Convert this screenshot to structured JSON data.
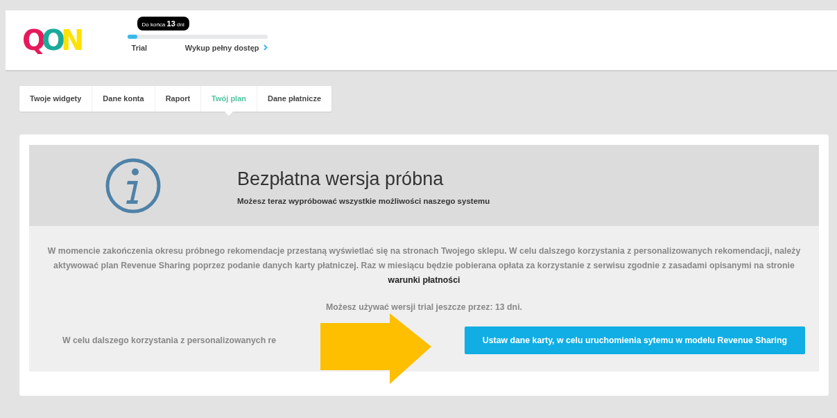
{
  "header": {
    "logo": "QON",
    "trial": {
      "badge_prefix": "Do końca",
      "badge_days": "13",
      "badge_suffix": "dni",
      "level": 0.07,
      "label": "Trial",
      "upgrade_link": "Wykup pełny dostęp"
    }
  },
  "tabs": [
    {
      "label": "Twoje widgety",
      "selected": false
    },
    {
      "label": "Dane konta",
      "selected": false
    },
    {
      "label": "Raport",
      "selected": false
    },
    {
      "label": "Twój plan",
      "selected": true
    },
    {
      "label": "Dane płatnicze",
      "selected": false
    }
  ],
  "plan": {
    "title": "Bezpłatna wersja próbna",
    "subtitle": "Możesz teraz wypróbować wszystkie możliwości naszego systemu",
    "description": "W momencie zakończenia okresu próbnego rekomendacje przestaną wyświetlać się na stronach Twojego sklepu. W celu dalszego korzystania z personalizowanych rekomendacji, należy aktywować plan Revenue Sharing poprzez podanie danych karty płatniczej. Raz w miesiącu będzie pobierana opłata za korzystanie z serwisu zgodnie z zasadami opisanymi na stronie",
    "terms_link": "warunki płatności",
    "remaining": "Możesz używać wersji trial jeszcze przez: 13 dni.",
    "cta_text": "W celu dalszego korzystania z personalizowanych re",
    "cta_button": "Ustaw dane karty, w celu uruchomienia sytemu w modelu Revenue Sharing"
  }
}
